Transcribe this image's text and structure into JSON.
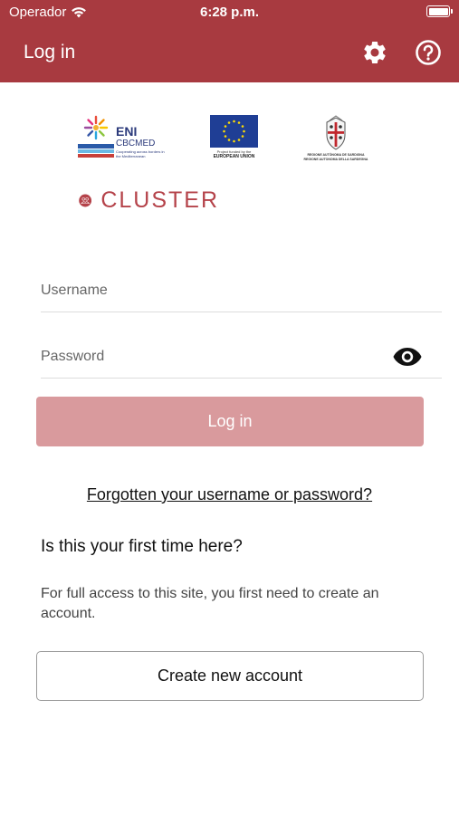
{
  "status_bar": {
    "carrier": "Operador",
    "time": "6:28 p.m.",
    "battery_level": 1.0
  },
  "header": {
    "title": "Log in",
    "settings_icon": "gear-icon",
    "help_icon": "question-circle-icon",
    "color": "#a83a40"
  },
  "logos": {
    "eni": {
      "name": "ENI",
      "sub": "CBCMED",
      "tagline": "Cooperating across borders in the Mediterranean"
    },
    "eu": {
      "caption": "Project funded by the",
      "name": "EUROPEAN UNION"
    },
    "sardegna": {
      "line1": "REGIONE AUTÒNOMA DE SARDIGNA",
      "line2": "REGIONE AUTONOMA DELLA SARDEGNA"
    },
    "cluster": {
      "name": "CLUSTER"
    }
  },
  "form": {
    "username_placeholder": "Username",
    "password_placeholder": "Password",
    "show_password_icon": "eye-icon",
    "login_label": "Log in",
    "login_button_color": "#d99a9d"
  },
  "forgot_link": "Forgotten your username or password?",
  "signup": {
    "heading": "Is this your first time here?",
    "info": "For full access to this site, you first need to create an account.",
    "button_label": "Create new account"
  }
}
